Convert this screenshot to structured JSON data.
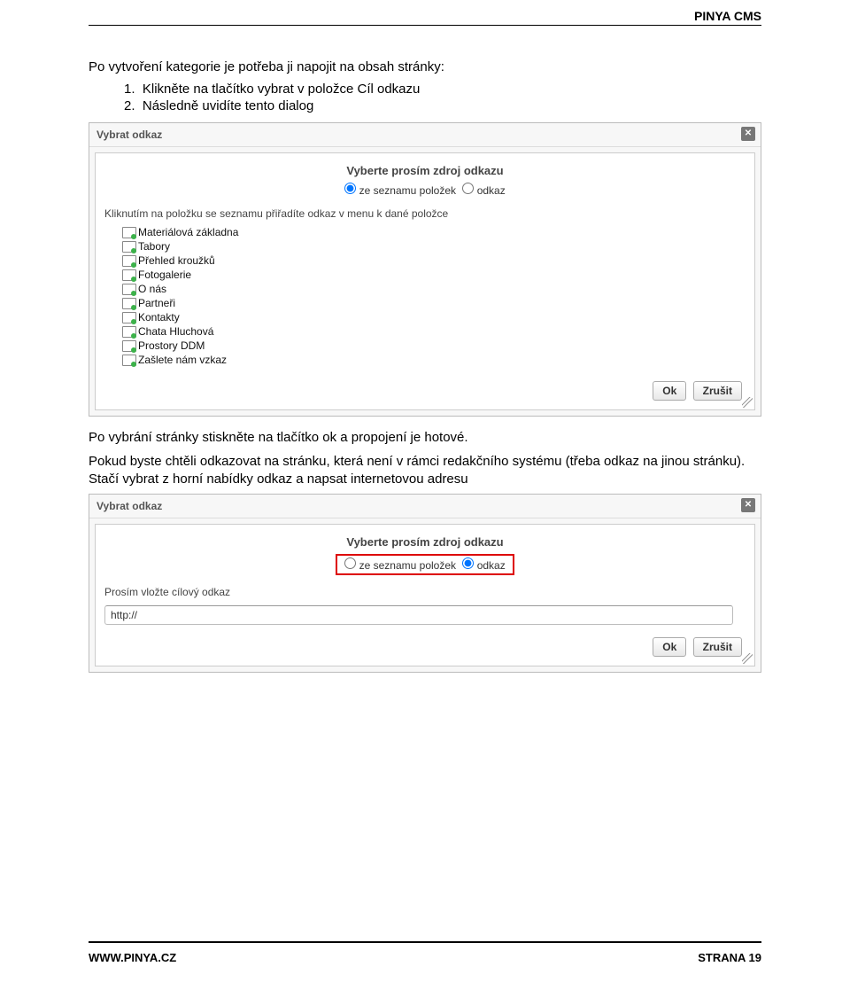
{
  "header": {
    "title": "PINYA CMS"
  },
  "intro": "Po vytvoření kategorie je potřeba ji napojit na obsah stránky:",
  "steps": [
    "Klikněte na tlačítko vybrat v položce Cíl odkazu",
    "Následně uvidíte tento dialog"
  ],
  "dialog1": {
    "title": "Vybrat odkaz",
    "heading": "Vyberte prosím zdroj odkazu",
    "radios": {
      "opt1": "ze seznamu položek",
      "opt2": "odkaz",
      "selected": "opt1"
    },
    "instruction": "Kliknutím na položku se seznamu přiřadíte odkaz v menu k dané položce",
    "items": [
      "Materiálová základna",
      "Tabory",
      "Přehled kroužků",
      "Fotogalerie",
      "O nás",
      "Partneři",
      "Kontakty",
      "Chata Hluchová",
      "Prostory DDM",
      "Zašlete nám vzkaz"
    ],
    "ok": "Ok",
    "cancel": "Zrušit"
  },
  "mid_para1": "Po vybrání stránky stiskněte na tlačítko ok a propojení je hotové.",
  "mid_para2": "Pokud byste chtěli odkazovat na stránku, která není v rámci redakčního systému (třeba odkaz na jinou stránku). Stačí vybrat z horní nabídky odkaz a napsat internetovou adresu",
  "dialog2": {
    "title": "Vybrat odkaz",
    "heading": "Vyberte prosím zdroj odkazu",
    "radios": {
      "opt1": "ze seznamu položek",
      "opt2": "odkaz",
      "selected": "opt2"
    },
    "url_label": "Prosím vložte cílový odkaz",
    "url_value": "http://",
    "ok": "Ok",
    "cancel": "Zrušit"
  },
  "footer": {
    "left": "WWW.PINYA.CZ",
    "right": "STRANA 19"
  }
}
